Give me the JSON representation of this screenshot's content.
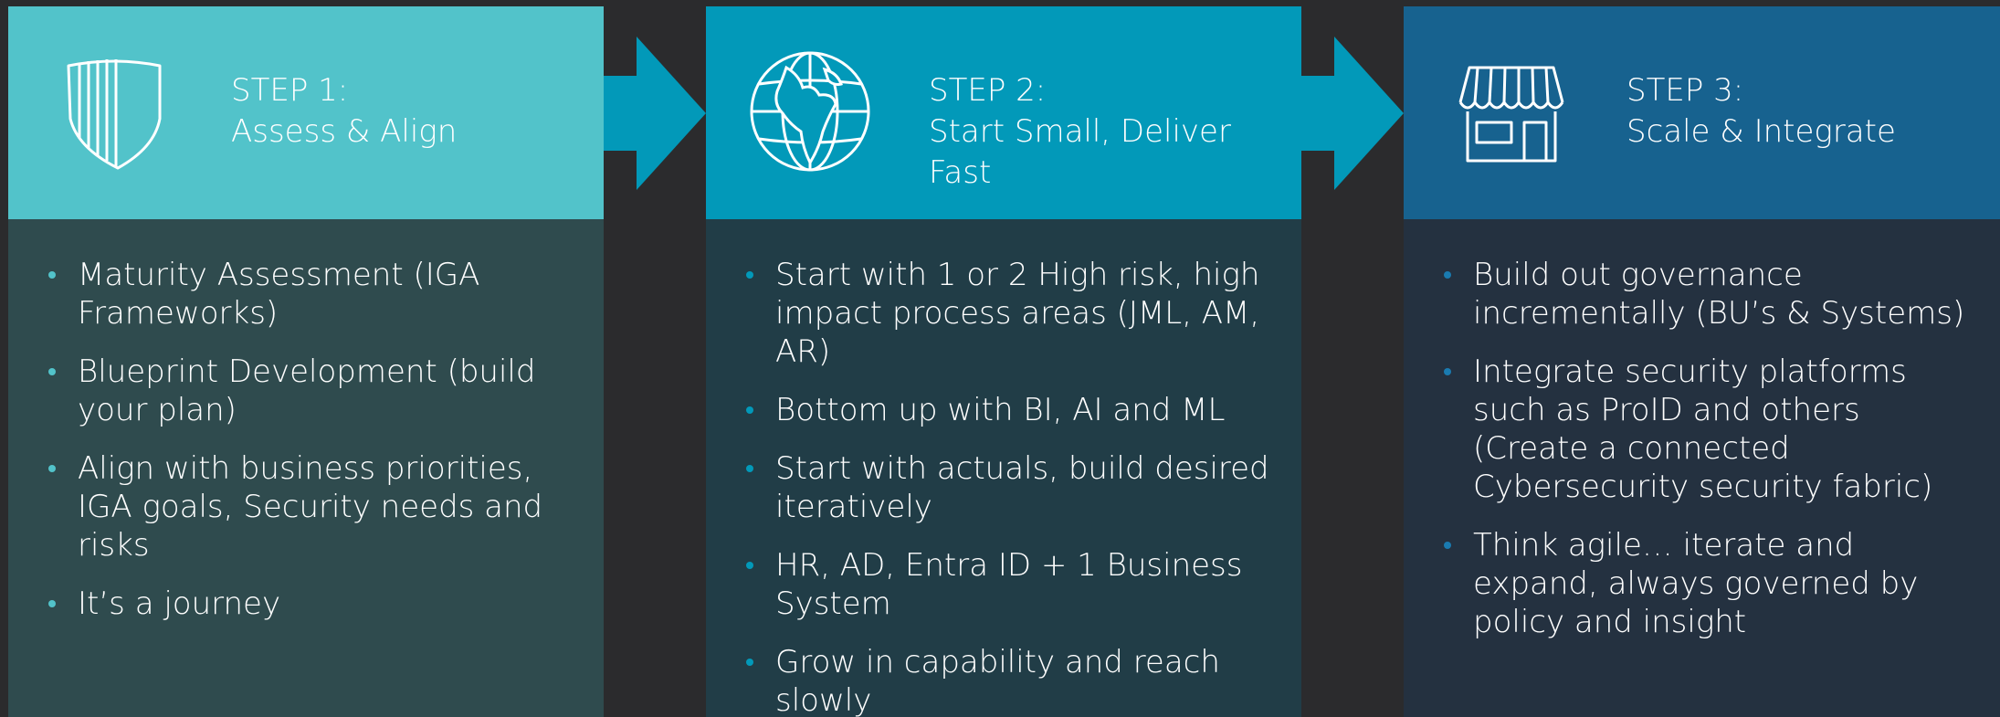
{
  "colors": {
    "step1_header": "#52c3ca",
    "step2_header": "#0299b9",
    "step3_header": "#17628f",
    "step1_body": "#2f4b4e",
    "step2_body": "#213d47",
    "step3_body": "#243140",
    "background": "#2b2b2d",
    "text": "#ffffff"
  },
  "steps": [
    {
      "icon": "shield-icon",
      "number": "STEP 1:",
      "title": "Assess & Align",
      "bullets": [
        "Maturity Assessment (IGA Frameworks)",
        "Blueprint Development (build your plan)",
        "Align with business priorities, IGA goals, Security needs and risks",
        "It’s a journey"
      ]
    },
    {
      "icon": "globe-icon",
      "number": "STEP 2:",
      "title": "Start Small, Deliver Fast",
      "bullets": [
        "Start with 1 or 2 High risk, high impact process areas (JML, AM, AR)",
        "Bottom up with BI, AI and ML",
        "Start with actuals, build desired iteratively",
        "HR, AD, Entra ID + 1 Business System",
        "Grow in capability and reach slowly"
      ]
    },
    {
      "icon": "storefront-icon",
      "number": "STEP 3:",
      "title": "Scale & Integrate",
      "bullets": [
        "Build out governance incrementally (BU’s & Systems)",
        "Integrate security platforms such as ProID and others (Create a connected Cybersecurity security fabric)",
        "Think agile… iterate and expand, always governed by policy and insight"
      ]
    }
  ]
}
